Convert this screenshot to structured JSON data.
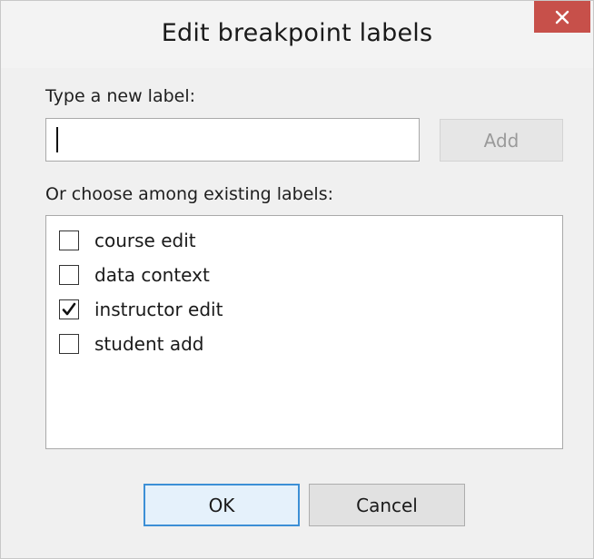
{
  "dialog": {
    "title": "Edit breakpoint labels",
    "close_glyph": "×"
  },
  "new_label": {
    "prompt": "Type a new label:",
    "value": "",
    "add_label": "Add",
    "add_enabled": false
  },
  "existing": {
    "prompt": "Or choose among existing labels:",
    "items": [
      {
        "label": "course edit",
        "checked": false
      },
      {
        "label": "data context",
        "checked": false
      },
      {
        "label": "instructor edit",
        "checked": true
      },
      {
        "label": "student add",
        "checked": false
      }
    ]
  },
  "buttons": {
    "ok": "OK",
    "cancel": "Cancel"
  },
  "colors": {
    "close_bg": "#c7504a",
    "ok_border": "#3c8fd6",
    "disabled_text": "#9a9a9a"
  }
}
